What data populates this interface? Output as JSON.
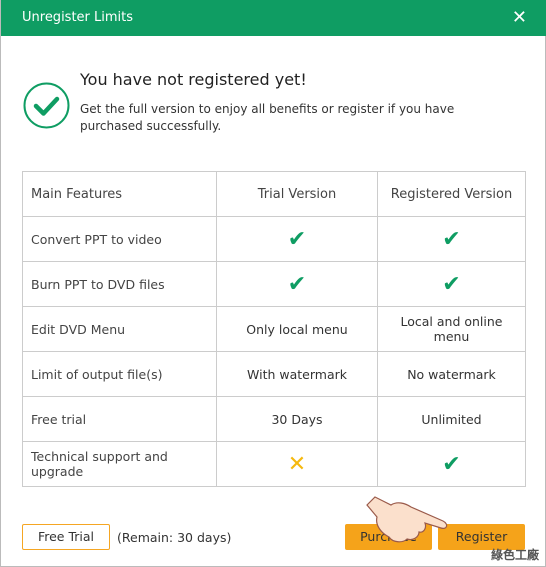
{
  "window": {
    "title": "Unregister Limits",
    "close_icon": "close-icon"
  },
  "message": {
    "icon": "check-circle-icon",
    "title": "You have not registered yet!",
    "body": "Get the full version to enjoy all benefits or register if you have purchased successfully."
  },
  "table": {
    "headers": [
      "Main Features",
      "Trial Version",
      "Registered Version"
    ],
    "rows": [
      {
        "feature": "Convert PPT to video",
        "trial": "✔",
        "registered": "✔"
      },
      {
        "feature": "Burn PPT to DVD files",
        "trial": "✔",
        "registered": "✔"
      },
      {
        "feature": "Edit DVD Menu",
        "trial": "Only local menu",
        "registered": "Local and online menu"
      },
      {
        "feature": "Limit of output file(s)",
        "trial": "With watermark",
        "registered": "No watermark"
      },
      {
        "feature": "Free trial",
        "trial": "30 Days",
        "registered": "Unlimited"
      },
      {
        "feature": "Technical support and upgrade",
        "trial": "✕",
        "registered": "✔"
      }
    ]
  },
  "footer": {
    "free_trial": "Free Trial",
    "remain": "(Remain: 30 days)",
    "purchase": "Purchase",
    "register": "Register"
  },
  "watermark": "綠色工廠",
  "colors": {
    "brand": "#0f9d63",
    "accent": "#f5a31a",
    "cross": "#f5b90f"
  }
}
